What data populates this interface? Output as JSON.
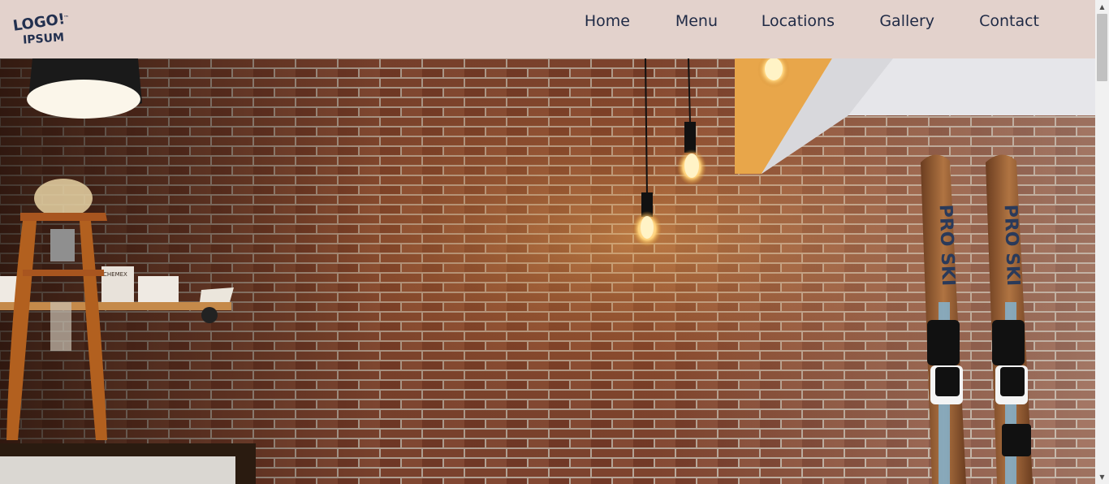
{
  "header": {
    "logo": {
      "line1": "LOGO!",
      "line2": "IPSUM",
      "tm": "™"
    },
    "nav": [
      {
        "label": "Home"
      },
      {
        "label": "Menu"
      },
      {
        "label": "Locations"
      },
      {
        "label": "Gallery"
      },
      {
        "label": "Contact"
      }
    ]
  },
  "hero": {
    "ski_text": "PRO SKI",
    "shelf_box_text": "CHEMEX"
  },
  "colors": {
    "header_bg": "#e3d2cc",
    "nav_text": "#1f2a45",
    "brick": "#8a4a33"
  },
  "scrollbar": {
    "up": "▲",
    "down": "▼"
  }
}
